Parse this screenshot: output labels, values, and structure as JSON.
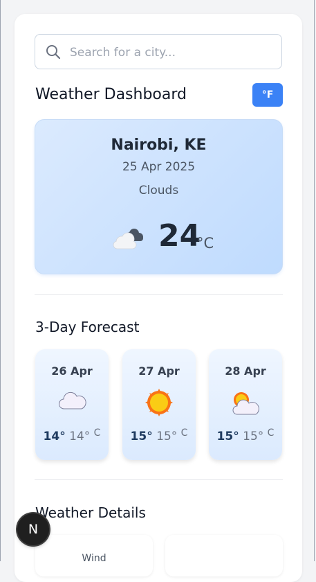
{
  "search": {
    "placeholder": "Search for a city..."
  },
  "header": {
    "title": "Weather Dashboard",
    "unit_toggle_label": "°F"
  },
  "current": {
    "city": "Nairobi, KE",
    "date": "25 Apr 2025",
    "condition": "Clouds",
    "icon": "broken-clouds-icon",
    "temperature": "24",
    "unit": "°C"
  },
  "forecast": {
    "title": "3-Day Forecast",
    "days": [
      {
        "date": "26 Apr",
        "icon": "cloud-icon",
        "max": "14°",
        "min": "14°",
        "unit": "C"
      },
      {
        "date": "27 Apr",
        "icon": "sun-icon",
        "max": "15°",
        "min": "15°",
        "unit": "C"
      },
      {
        "date": "28 Apr",
        "icon": "partly-cloudy-icon",
        "max": "15°",
        "min": "15°",
        "unit": "C"
      }
    ]
  },
  "details": {
    "title": "Weather Details",
    "wind_label": "Wind"
  },
  "fab": {
    "label": "N"
  },
  "colors": {
    "accent": "#3b82f6",
    "card_gradient_start": "#dbeafe",
    "card_gradient_end": "#bfdbfe"
  }
}
